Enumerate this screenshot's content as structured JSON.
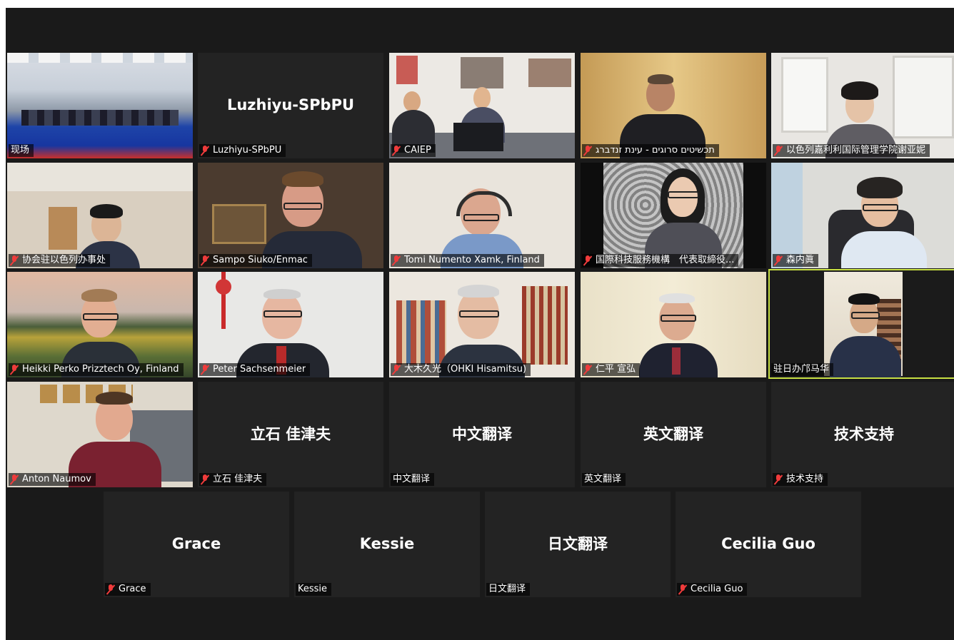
{
  "meeting": {
    "participants": [
      {
        "name": "现场",
        "muted": false
      },
      {
        "name": "Luzhiyu-SPbPU",
        "muted": true,
        "video": false
      },
      {
        "name": "CAIEP",
        "muted": true
      },
      {
        "name": "תכשיטים סרוגים - עינת זנדברג",
        "muted": true
      },
      {
        "name": "以色列嘉利利国际管理学院谢亚妮",
        "muted": true
      },
      {
        "name": "协会驻以色列办事处",
        "muted": true
      },
      {
        "name": "Sampo Siuko/Enmac",
        "muted": true
      },
      {
        "name": "Tomi Numento Xamk, Finland",
        "muted": true
      },
      {
        "name": "国際科技服務機構　代表取締役...",
        "muted": true
      },
      {
        "name": "森内眞",
        "muted": true
      },
      {
        "name": "Heikki Perko Prizztech Oy, Finland",
        "muted": true
      },
      {
        "name": "Peter Sachsenmeier",
        "muted": true
      },
      {
        "name": "大木久光（OHKI Hisamitsu)",
        "muted": true
      },
      {
        "name": "仁平 宣弘",
        "muted": true
      },
      {
        "name": "驻日办邝马华",
        "muted": false,
        "active_speaker": true
      },
      {
        "name": "Anton Naumov",
        "muted": true
      },
      {
        "name": "立石 佳津夫",
        "muted": true,
        "video": false
      },
      {
        "name": "中文翻译",
        "muted": false,
        "video": false
      },
      {
        "name": "英文翻译",
        "muted": false,
        "video": false
      },
      {
        "name": "技术支持",
        "muted": true,
        "video": false
      },
      {
        "name": "Grace",
        "muted": true,
        "video": false
      },
      {
        "name": "Kessie",
        "muted": false,
        "video": false
      },
      {
        "name": "日文翻译",
        "muted": false,
        "video": false
      },
      {
        "name": "Cecilia Guo",
        "muted": true,
        "video": false
      }
    ]
  },
  "colors": {
    "background": "#1a1a1a",
    "tile": "#232323",
    "muted_icon": "#ef3b3b",
    "active_speaker_border": "#c7df43"
  }
}
